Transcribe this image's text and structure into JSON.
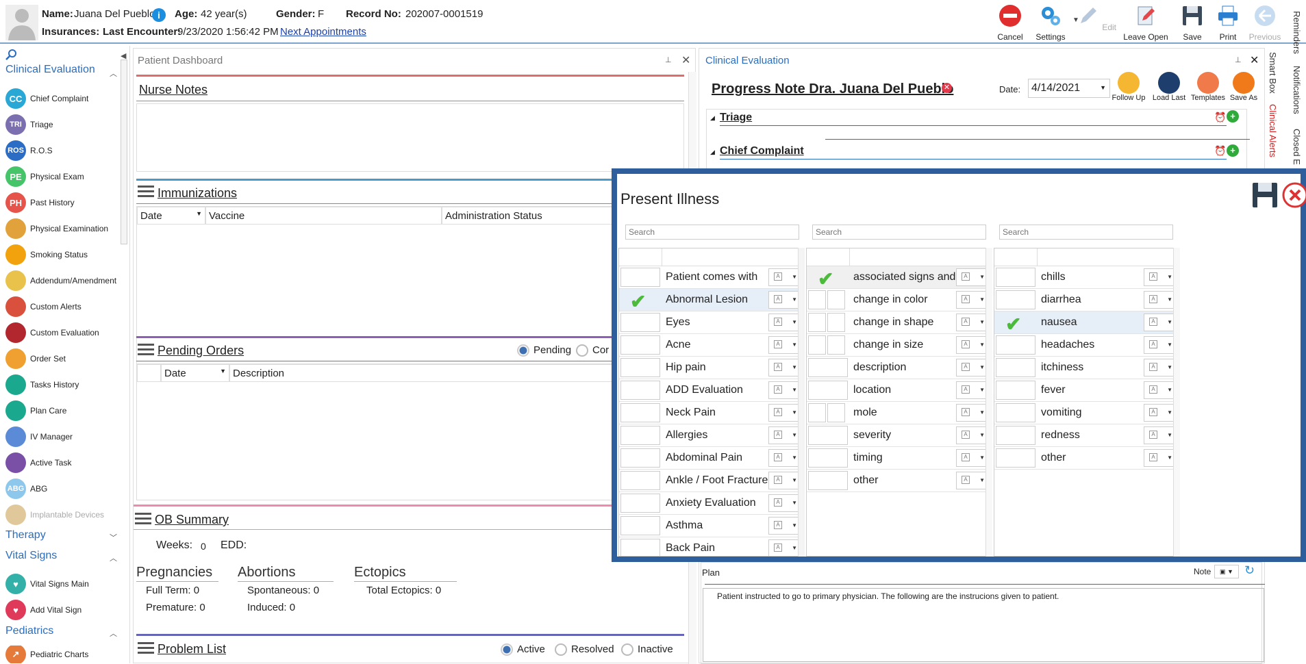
{
  "patient": {
    "name_label": "Name:",
    "name": "Juana Del Pueblo",
    "age_label": "Age:",
    "age": "42 year(s)",
    "gender_label": "Gender:",
    "gender": "F",
    "record_label": "Record No:",
    "record": "202007-0001519",
    "insurances_label": "Insurances:",
    "last_encounter_label": "Last Encounter:",
    "last_encounter": "9/23/2020 1:56:42 PM",
    "next_appointments": "Next Appointments"
  },
  "toolbar": {
    "cancel": "Cancel",
    "settings": "Settings",
    "edit": "Edit",
    "leave_open": "Leave Open",
    "save": "Save",
    "print": "Print",
    "previous": "Previous"
  },
  "right_tabs": [
    "Reminders",
    "Notifications",
    "Closed E"
  ],
  "right_tabs2": [
    "Smart Box",
    "Clinical Alerts"
  ],
  "sidebar": {
    "clinical_evaluation": "Clinical Evaluation",
    "items": [
      {
        "label": "Chief Complaint",
        "abbr": "CC",
        "color": "#29a8d6"
      },
      {
        "label": "Triage",
        "abbr": "TRI",
        "color": "#7b6fb0"
      },
      {
        "label": "R.O.S",
        "abbr": "ROS",
        "color": "#2b6cc4"
      },
      {
        "label": "Physical Exam",
        "abbr": "PE",
        "color": "#46c46a"
      },
      {
        "label": "Past History",
        "abbr": "PH",
        "color": "#e5534b"
      },
      {
        "label": "Physical Examination",
        "abbr": "",
        "color": "#e2a23b"
      },
      {
        "label": "Smoking Status",
        "abbr": "",
        "color": "#f2a20c"
      },
      {
        "label": "Addendum/Amendment",
        "abbr": "",
        "color": "#e8c24a"
      },
      {
        "label": "Custom Alerts",
        "abbr": "",
        "color": "#d9513c"
      },
      {
        "label": "Custom Evaluation",
        "abbr": "",
        "color": "#b2262e"
      },
      {
        "label": "Order Set",
        "abbr": "",
        "color": "#f0a030"
      },
      {
        "label": "Tasks History",
        "abbr": "",
        "color": "#1aa88f"
      },
      {
        "label": "Plan Care",
        "abbr": "",
        "color": "#1aa88f"
      },
      {
        "label": "IV Manager",
        "abbr": "",
        "color": "#5b8bd6"
      },
      {
        "label": "Active Task",
        "abbr": "",
        "color": "#7a4fa6"
      },
      {
        "label": "ABG",
        "abbr": "ABG",
        "color": "#8ec7ec"
      },
      {
        "label": "Implantable Devices",
        "abbr": "",
        "color": "#e0c89a"
      }
    ],
    "therapy": "Therapy",
    "vital_signs": "Vital Signs",
    "vital_items": [
      {
        "label": "Vital Signs Main",
        "color": "#33b0a8"
      },
      {
        "label": "Add Vital Sign",
        "color": "#e03a5a"
      }
    ],
    "pediatrics": "Pediatrics",
    "pediatric_items": [
      {
        "label": "Pediatric Charts",
        "color": "#e57a3a"
      }
    ]
  },
  "dashboard": {
    "title": "Patient Dashboard",
    "nurse_notes": "Nurse Notes",
    "immunizations": "Immunizations",
    "imm_cols": [
      "Date",
      "Vaccine",
      "Administration Status"
    ],
    "pending_orders": "Pending Orders",
    "pending": "Pending",
    "completed": "Cor",
    "po_cols": [
      "Date",
      "Description"
    ],
    "ob_summary": "OB Summary",
    "weeks_label": "Weeks:",
    "weeks": "0",
    "edd_label": "EDD:",
    "pregnancies": "Pregnancies",
    "full_term": "Full Term: 0",
    "premature": "Premature: 0",
    "abortions": "Abortions",
    "spontaneous": "Spontaneous: 0",
    "induced": "Induced: 0",
    "ectopics": "Ectopics",
    "total_ectopics": "Total Ectopics: 0",
    "problem_list": "Problem List",
    "active": "Active",
    "resolved": "Resolved",
    "inactive": "Inactive"
  },
  "clinical": {
    "title": "Clinical Evaluation",
    "note_title": "Progress Note Dra. Juana Del Pueblo",
    "date_label": "Date:",
    "date": "4/14/2021",
    "follow_up": "Follow Up",
    "load_last": "Load Last",
    "templates": "Templates",
    "save_as": "Save As",
    "triage": "Triage",
    "chief_complaint": "Chief Complaint",
    "plan": "Plan",
    "note": "Note",
    "plan_text": "Patient instructed to go to primary physician.  The following are the instrucions given to patient."
  },
  "popup": {
    "title": "Present Illness",
    "search_placeholder": "Search",
    "col1": [
      {
        "label": "Patient comes with",
        "checked": false
      },
      {
        "label": "Abnormal Lesion",
        "checked": true
      },
      {
        "label": "Eyes",
        "checked": false
      },
      {
        "label": "Acne",
        "checked": false
      },
      {
        "label": "Hip pain",
        "checked": false
      },
      {
        "label": "ADD Evaluation",
        "checked": false
      },
      {
        "label": "Neck Pain",
        "checked": false
      },
      {
        "label": "Allergies",
        "checked": false
      },
      {
        "label": "Abdominal Pain",
        "checked": false
      },
      {
        "label": "Ankle / Foot Fracture",
        "checked": false
      },
      {
        "label": "Anxiety Evaluation",
        "checked": false
      },
      {
        "label": "Asthma",
        "checked": false
      },
      {
        "label": "Back Pain",
        "checked": false
      }
    ],
    "col2": [
      {
        "label": "associated signs and sym...",
        "checked": true
      },
      {
        "label": "change in color",
        "checked": false
      },
      {
        "label": "change in shape",
        "checked": false
      },
      {
        "label": "change in size",
        "checked": false
      },
      {
        "label": "description",
        "checked": false
      },
      {
        "label": "location",
        "checked": false
      },
      {
        "label": "mole",
        "checked": false
      },
      {
        "label": "severity",
        "checked": false
      },
      {
        "label": "timing",
        "checked": false
      },
      {
        "label": "other",
        "checked": false
      }
    ],
    "col3": [
      {
        "label": "chills",
        "checked": false
      },
      {
        "label": "diarrhea",
        "checked": false
      },
      {
        "label": "nausea",
        "checked": true
      },
      {
        "label": "headaches",
        "checked": false
      },
      {
        "label": "itchiness",
        "checked": false
      },
      {
        "label": "fever",
        "checked": false
      },
      {
        "label": "vomiting",
        "checked": false
      },
      {
        "label": "redness",
        "checked": false
      },
      {
        "label": "other",
        "checked": false
      }
    ]
  }
}
